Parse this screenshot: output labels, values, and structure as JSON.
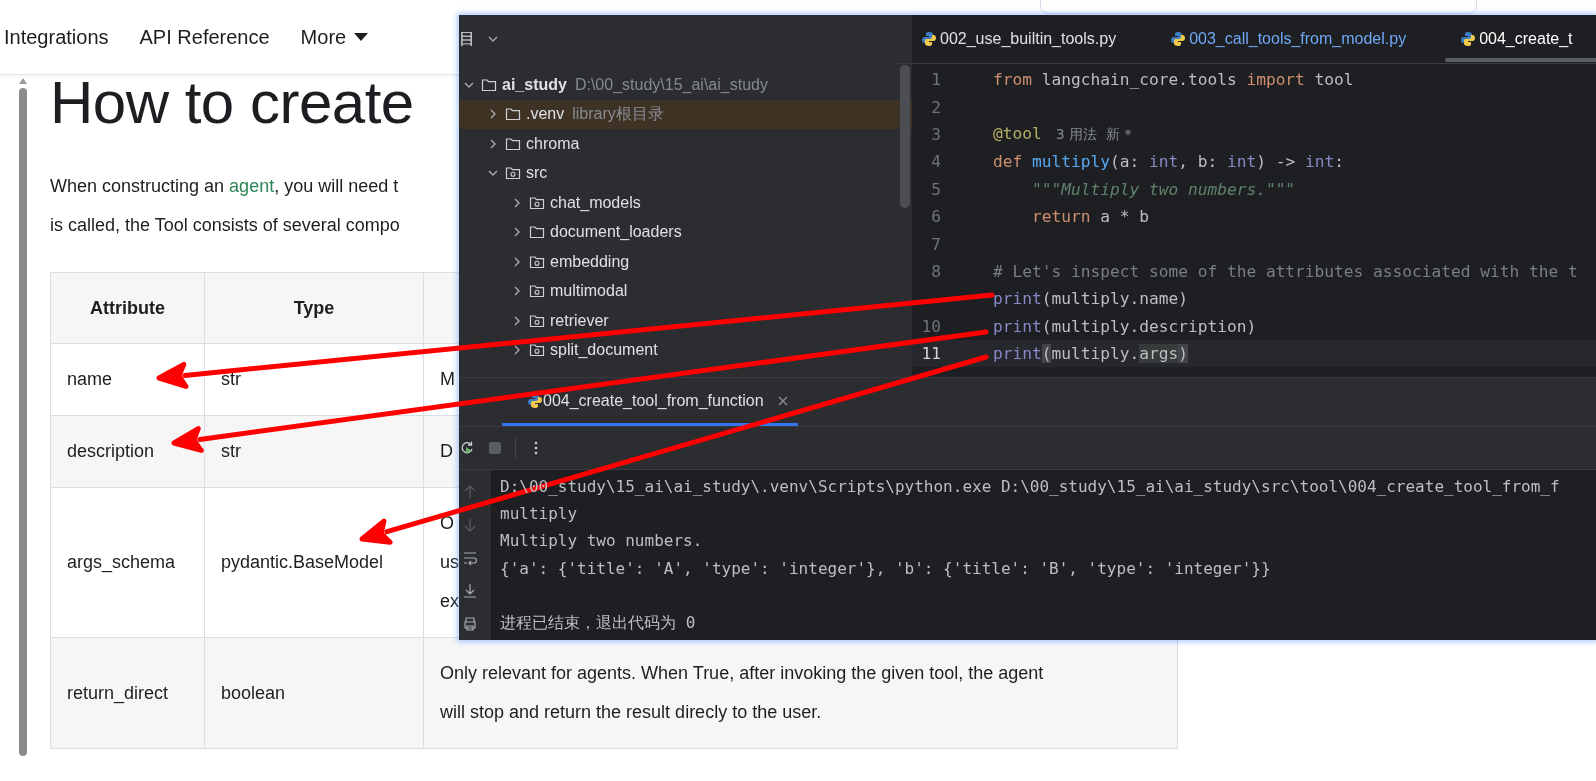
{
  "nav": {
    "links": [
      {
        "label": "Integrations",
        "dropdown": false
      },
      {
        "label": "API Reference",
        "dropdown": false
      },
      {
        "label": "More",
        "dropdown": true
      }
    ]
  },
  "article": {
    "title": "How to create",
    "intro": [
      [
        {
          "text": "When constructing an ",
          "link": false
        },
        {
          "text": "agent",
          "link": true
        },
        {
          "text": ", you will need t",
          "link": false
        }
      ],
      [
        {
          "text": "is called, the Tool consists of several compo",
          "link": false
        }
      ]
    ],
    "table": {
      "columns": [
        "Attribute",
        "Type"
      ],
      "rows": [
        {
          "attribute": "name",
          "type": "str",
          "column_3": [
            "M"
          ]
        },
        {
          "attribute": "description",
          "type": "str",
          "column_3": [
            "D"
          ]
        },
        {
          "attribute": "args_schema",
          "type": "pydantic.BaseModel",
          "column_3": [
            "O",
            "us",
            "ex"
          ]
        },
        {
          "attribute": "return_direct",
          "type": "boolean",
          "column_3": [
            "Only relevant for agents. When True, after invoking the given tool, the agent",
            "will stop and return the result direcly to the user."
          ]
        }
      ]
    }
  },
  "ide": {
    "project_panel": {
      "title": "目",
      "tree": [
        {
          "name": "ai_study",
          "hint": "D:\\00_study\\15_ai\\ai_study",
          "kind": "folder",
          "expanded": true,
          "highlighted": false,
          "children": [
            {
              "name": ".venv",
              "hint": "library根目录",
              "kind": "folder",
              "expanded": false,
              "highlighted": true
            },
            {
              "name": "chroma",
              "kind": "folder",
              "expanded": false,
              "highlighted": false
            },
            {
              "name": "src",
              "kind": "package",
              "expanded": true,
              "highlighted": false,
              "children": [
                {
                  "name": "chat_models",
                  "kind": "package",
                  "expanded": false,
                  "highlighted": false
                },
                {
                  "name": "document_loaders",
                  "kind": "folder",
                  "expanded": false,
                  "highlighted": false
                },
                {
                  "name": "embedding",
                  "kind": "package",
                  "expanded": false,
                  "highlighted": false
                },
                {
                  "name": "multimodal",
                  "kind": "package",
                  "expanded": false,
                  "highlighted": false
                },
                {
                  "name": "retriever",
                  "kind": "package",
                  "expanded": false,
                  "highlighted": false
                },
                {
                  "name": "split_document",
                  "kind": "package",
                  "expanded": false,
                  "highlighted": false
                }
              ]
            }
          ]
        }
      ]
    },
    "editor": {
      "tabs": [
        {
          "label": "002_use_builtin_tools.py",
          "selected": false,
          "modified": false
        },
        {
          "label": "003_call_tools_from_model.py",
          "selected": false,
          "modified": true
        },
        {
          "label": "004_create_t",
          "selected": true,
          "modified": false
        }
      ],
      "lines": [
        {
          "number": "1",
          "current": false,
          "segments": [
            {
              "text": "from",
              "kind": "keyword"
            },
            {
              "text": " langchain_core.tools ",
              "kind": "plain"
            },
            {
              "text": "import",
              "kind": "keyword"
            },
            {
              "text": " tool",
              "kind": "plain"
            }
          ]
        },
        {
          "number": "2",
          "current": false
        },
        {
          "number": "3",
          "current": false,
          "segments": [
            {
              "text": "@tool",
              "kind": "decorator"
            },
            {
              "text": "3 用法  新 *",
              "kind": "hint"
            }
          ]
        },
        {
          "number": "4",
          "current": false,
          "segments": [
            {
              "text": "def ",
              "kind": "keyword"
            },
            {
              "text": "multiply",
              "kind": "function"
            },
            {
              "text": "(a: ",
              "kind": "plain"
            },
            {
              "text": "int",
              "kind": "builtin"
            },
            {
              "text": ", b: ",
              "kind": "plain"
            },
            {
              "text": "int",
              "kind": "builtin"
            },
            {
              "text": ") -> ",
              "kind": "plain"
            },
            {
              "text": "int",
              "kind": "builtin"
            },
            {
              "text": ":",
              "kind": "plain"
            }
          ]
        },
        {
          "number": "5",
          "current": false,
          "segments": [
            {
              "text": "    \"\"\"Multiply two numbers.\"\"\"",
              "kind": "doc"
            }
          ]
        },
        {
          "number": "6",
          "current": false,
          "segments": [
            {
              "text": "    return",
              "kind": "keyword"
            },
            {
              "text": " a * b",
              "kind": "plain"
            }
          ]
        },
        {
          "number": "7",
          "current": false
        },
        {
          "number": "8",
          "current": false,
          "segments": [
            {
              "text": "# Let's inspect some of the attributes associated with the t",
              "kind": "comment"
            }
          ]
        },
        {
          "current": false,
          "segments": [
            {
              "text": "print",
              "kind": "builtin"
            },
            {
              "text": "(multiply.name)",
              "kind": "plain"
            }
          ]
        },
        {
          "number": "10",
          "current": false,
          "segments": [
            {
              "text": "print",
              "kind": "builtin"
            },
            {
              "text": "(multiply.description)",
              "kind": "plain"
            }
          ]
        },
        {
          "number": "11",
          "current": true,
          "segments": [
            {
              "text": "print",
              "kind": "builtin"
            },
            {
              "text": "(",
              "kind": "brace"
            },
            {
              "text": "multiply.",
              "kind": "plain"
            },
            {
              "text": "args",
              "kind": "usage"
            },
            {
              "text": ")",
              "kind": "brace"
            }
          ]
        }
      ]
    },
    "run_panel": {
      "tabs": [
        {
          "label": "004_create_tool_from_function",
          "selected": true
        }
      ],
      "output": [
        {
          "text": "D:\\00_study\\15_ai\\ai_study\\.venv\\Scripts\\python.exe D:\\00_study\\15_ai\\ai_study\\src\\tool\\004_create_tool_from_f",
          "kind": "stdout"
        },
        {
          "text": "multiply",
          "kind": "stdout"
        },
        {
          "text": "Multiply two numbers.",
          "kind": "stdout"
        },
        {
          "text": "{'a': {'title': 'A', 'type': 'integer'}, 'b': {'title': 'B', 'type': 'integer'}}",
          "kind": "stdout"
        },
        {
          "text": "进程已结束，退出代码为 0",
          "kind": "exit"
        }
      ]
    }
  }
}
